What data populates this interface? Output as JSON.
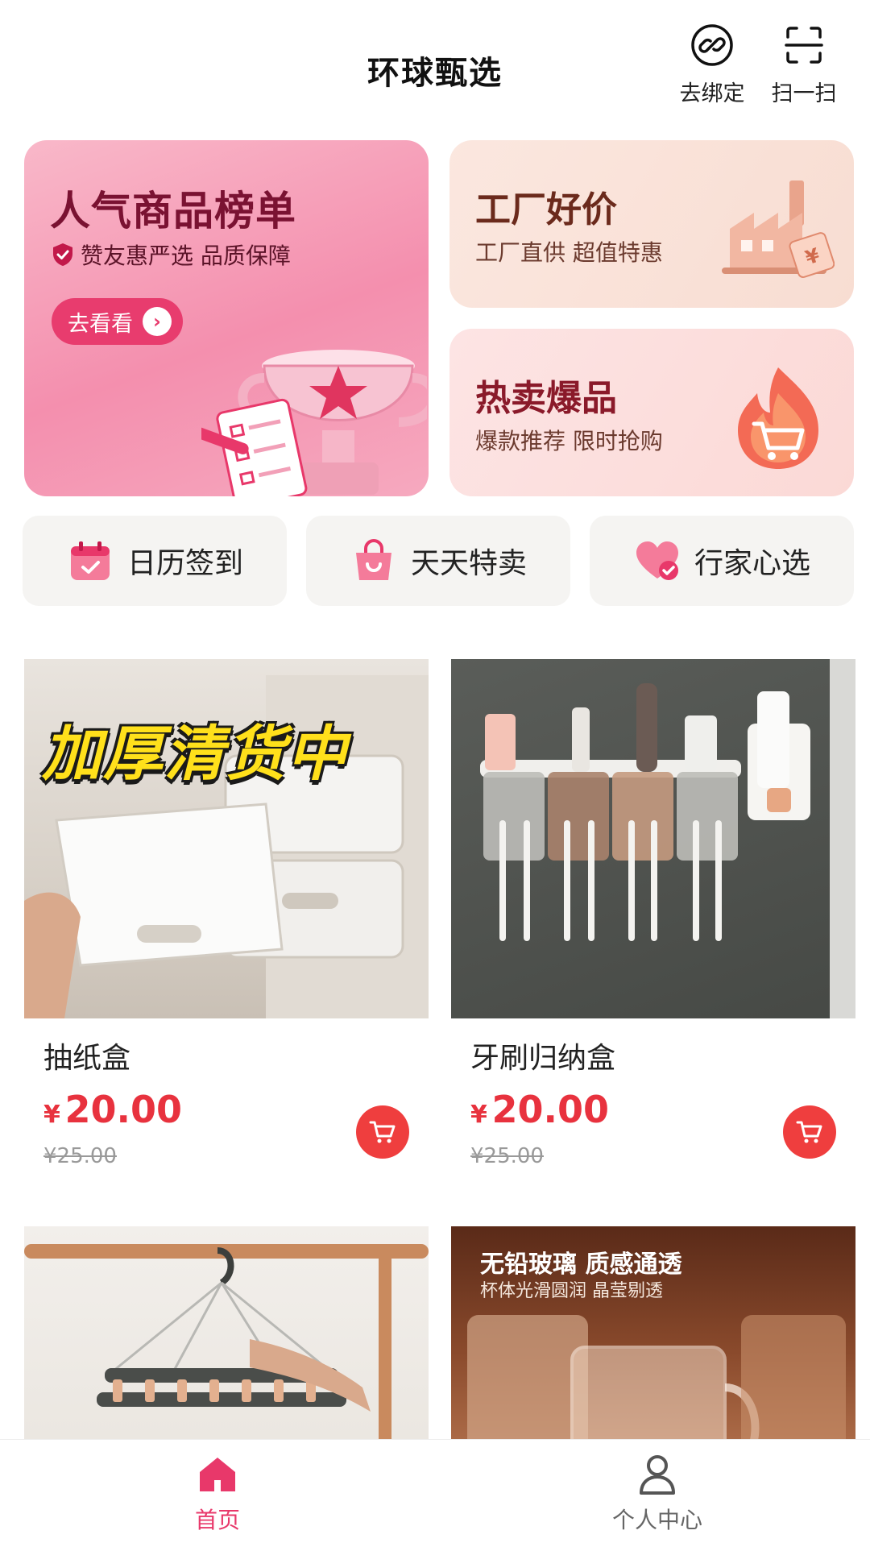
{
  "header": {
    "title": "环球甄选",
    "bind_label": "去绑定",
    "scan_label": "扫一扫"
  },
  "banners": {
    "ranking": {
      "title": "人气商品榜单",
      "subtitle": "赞友惠严选 品质保障",
      "button": "去看看"
    },
    "factory": {
      "title": "工厂好价",
      "subtitle": "工厂直供 超值特惠",
      "price_tag": "¥"
    },
    "hot": {
      "title": "热卖爆品",
      "subtitle": "爆款推荐 限时抢购"
    }
  },
  "quick_tiles": [
    {
      "label": "日历签到",
      "icon": "calendar-check-icon"
    },
    {
      "label": "天天特卖",
      "icon": "shopping-bag-icon"
    },
    {
      "label": "行家心选",
      "icon": "heart-check-icon"
    }
  ],
  "products": [
    {
      "name": "抽纸盒",
      "currency": "¥",
      "price": "20.00",
      "original_price": "¥25.00",
      "promo_text": "加厚清货中"
    },
    {
      "name": "牙刷归纳盒",
      "currency": "¥",
      "price": "20.00",
      "original_price": "¥25.00"
    },
    {
      "name": "",
      "currency": "",
      "price": "",
      "original_price": ""
    },
    {
      "name": "",
      "currency": "",
      "price": "",
      "original_price": "",
      "promo_title": "无铅玻璃 质感通透",
      "promo_sub": "杯体光滑圆润  晶莹剔透"
    }
  ],
  "bottom_nav": {
    "home": "首页",
    "me": "个人中心"
  },
  "colors": {
    "accent": "#e8386a",
    "price": "#e8323e",
    "cart": "#ef3e3e"
  }
}
